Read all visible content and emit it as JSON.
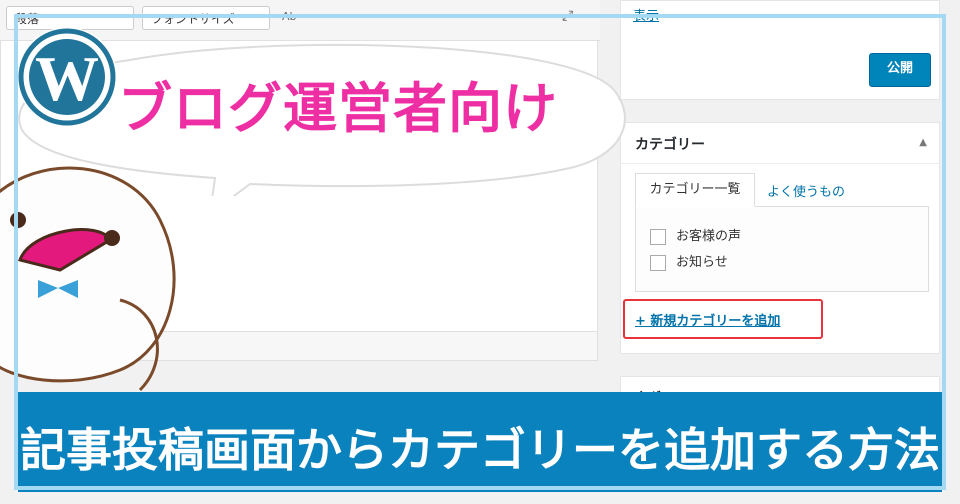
{
  "toolbar": {
    "format_select": "段落",
    "font_select": "フォントサイズ",
    "extra_text": "Ab"
  },
  "sidebar": {
    "preview_link": "表示",
    "publish_button": "公開",
    "categories": {
      "title": "カテゴリー",
      "tab_all": "カテゴリー一覧",
      "tab_popular": "よく使うもの",
      "items": [
        {
          "label": "お客様の声",
          "checked": false
        },
        {
          "label": "お知らせ",
          "checked": false
        }
      ],
      "add_link": "+ 新規カテゴリーを追加"
    },
    "next_box_label": "タグ"
  },
  "bubble": {
    "text": "ブログ運営者向け"
  },
  "banner": {
    "text": "記事投稿画面からカテゴリーを追加する方法"
  },
  "colors": {
    "frame": "#a3d9f3",
    "bubble_text": "#ee2fa4",
    "banner": "#0a82bd",
    "wp_logo": "#21759b",
    "highlight": "#e8323c",
    "publish": "#0085ba"
  }
}
